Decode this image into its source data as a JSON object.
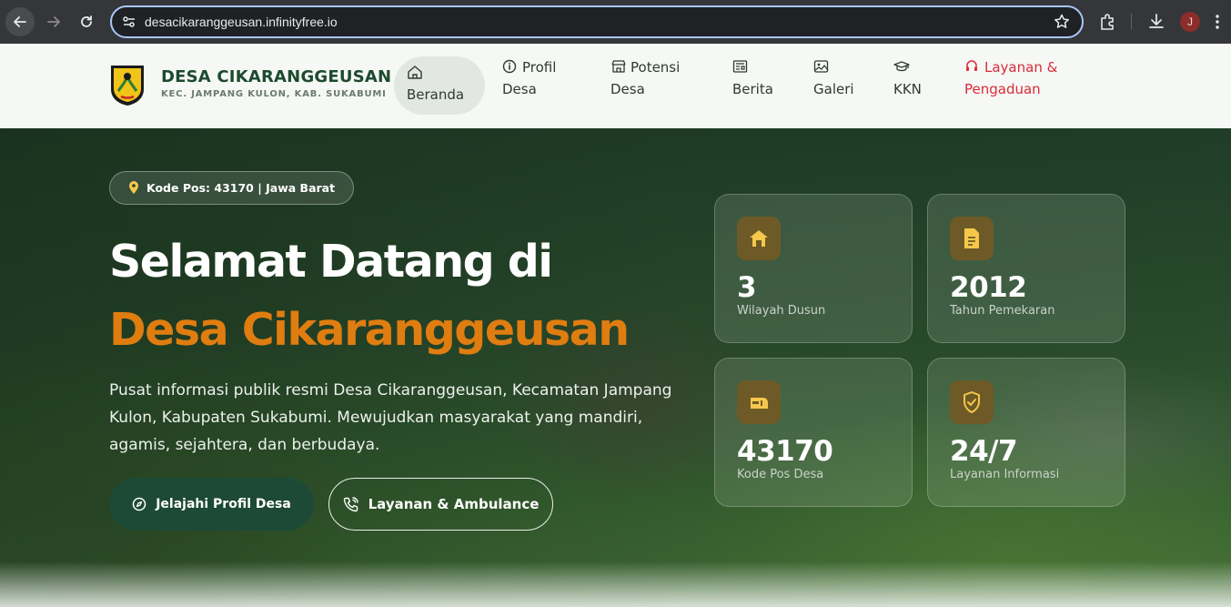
{
  "browser": {
    "url": "desacikaranggeusan.infinityfree.io",
    "profile_initial": "J"
  },
  "header": {
    "brand_name": "DESA CIKARANGGEUSAN",
    "brand_sub": "KEC. JAMPANG KULON, KAB. SUKABUMI",
    "nav": [
      {
        "line1": "",
        "line2": "Beranda"
      },
      {
        "line1": "Profil",
        "line2": "Desa"
      },
      {
        "line1": "Potensi",
        "line2": "Desa"
      },
      {
        "line1": "",
        "line2": "Berita"
      },
      {
        "line1": "",
        "line2": "Galeri"
      },
      {
        "line1": "",
        "line2": "KKN"
      },
      {
        "line1": "Layanan &",
        "line2": "Pengaduan"
      }
    ]
  },
  "hero": {
    "badge": "Kode Pos: 43170 | Jawa Barat",
    "title_line1": "Selamat Datang di",
    "title_line2": "Desa Cikaranggeusan",
    "description": "Pusat informasi publik resmi Desa Cikaranggeusan, Kecamatan Jampang Kulon, Kabupaten Sukabumi. Mewujudkan masyarakat yang mandiri, agamis, sejahtera, dan berbudaya.",
    "btn_primary": "Jelajahi Profil Desa",
    "btn_secondary": "Layanan & Ambulance",
    "stats": [
      {
        "value": "3",
        "label": "Wilayah Dusun",
        "icon": "home-icon"
      },
      {
        "value": "2012",
        "label": "Tahun Pemekaran",
        "icon": "document-icon"
      },
      {
        "value": "43170",
        "label": "Kode Pos Desa",
        "icon": "mailbox-icon"
      },
      {
        "value": "24/7",
        "label": "Layanan Informasi",
        "icon": "shield-check-icon"
      }
    ]
  },
  "colors": {
    "accent_orange": "#e07d10",
    "brand_green": "#1d4a36",
    "alert_red": "#d92b3a",
    "icon_gold": "#f5c84c"
  }
}
